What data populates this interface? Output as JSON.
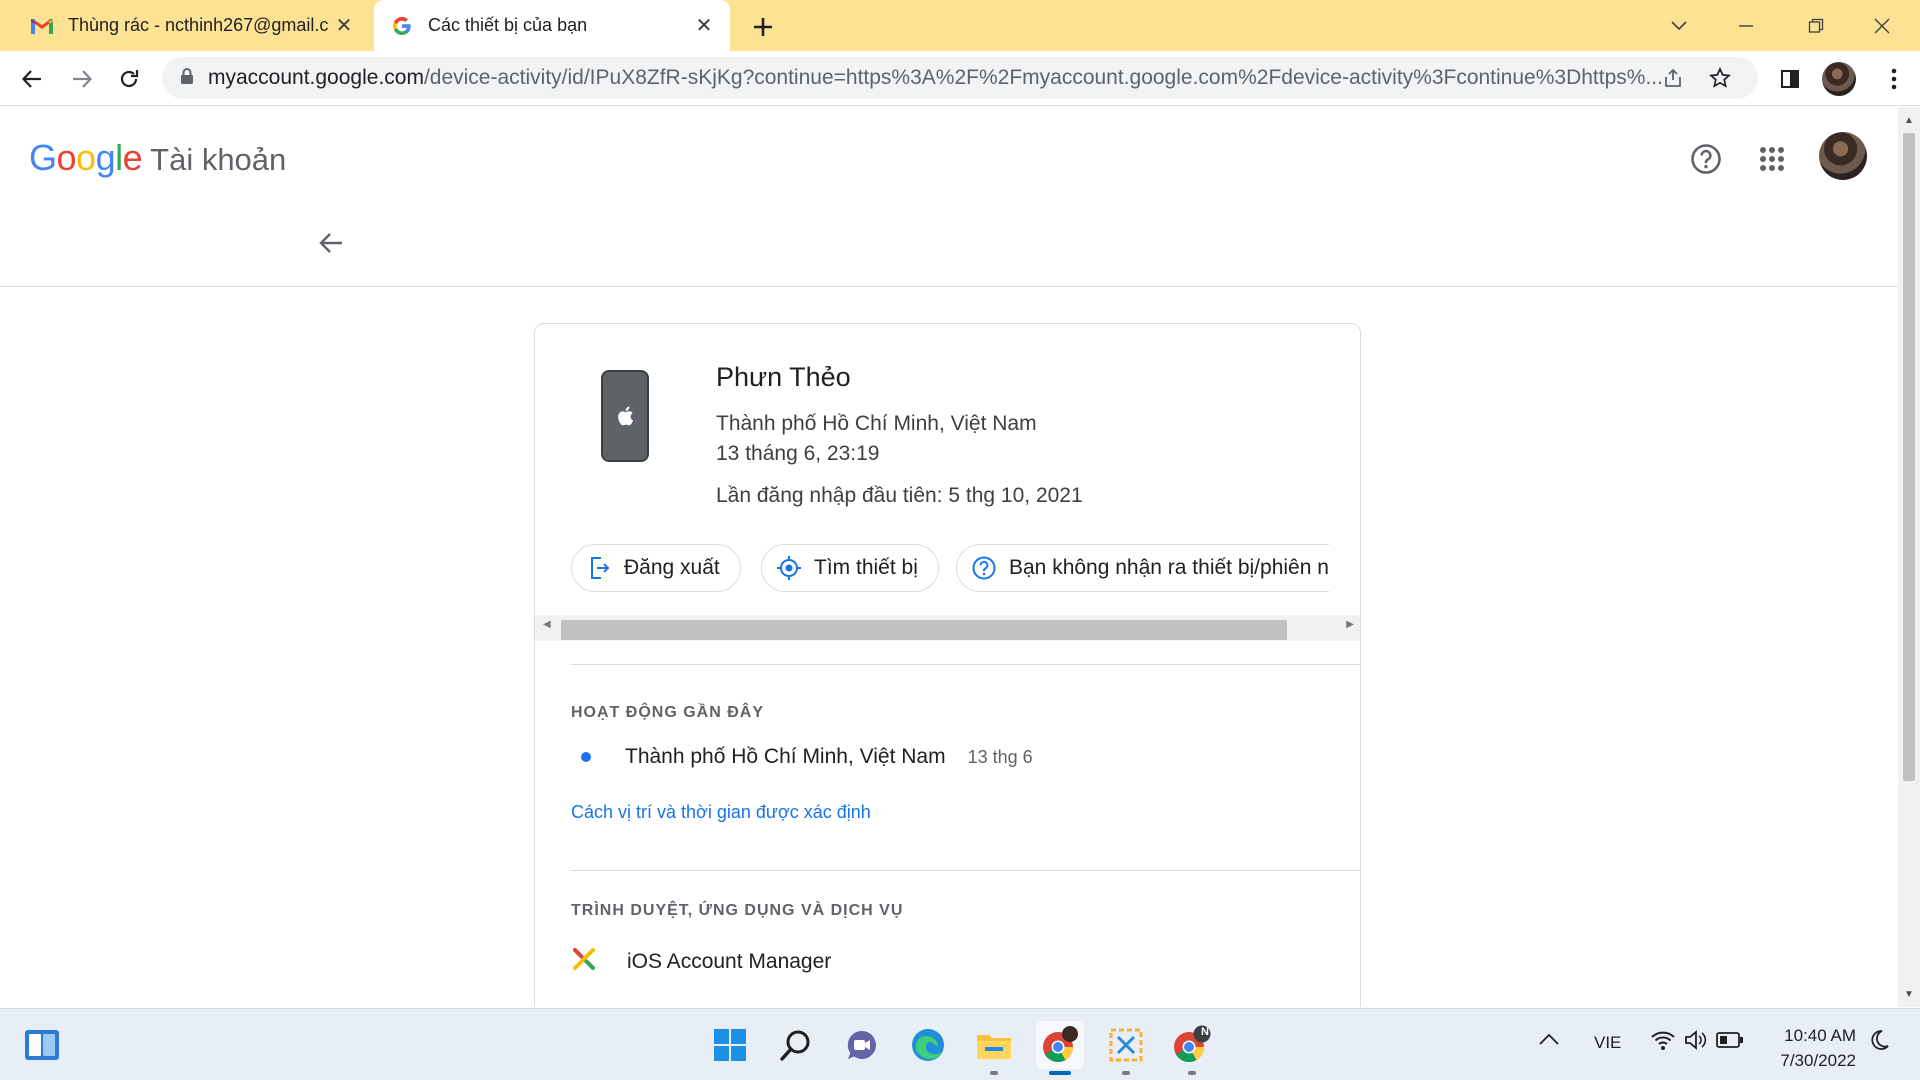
{
  "browser": {
    "tabs": [
      {
        "title": "Thùng rác - ncthinh267@gmail.c",
        "favicon": "gmail-icon",
        "active": false
      },
      {
        "title": "Các thiết bị của bạn",
        "favicon": "google-g-icon",
        "active": true
      }
    ],
    "url_host": "myaccount.google.com",
    "url_path": "/device-activity/id/IPuX8ZfR-sKjKg?continue=https%3A%2F%2Fmyaccount.google.com%2Fdevice-activity%3Fcontinue%3Dhttps%..."
  },
  "header": {
    "logo_text": "Google",
    "product": "Tài khoản"
  },
  "device": {
    "name": "Phưn Thẻo",
    "location": "Thành phố Hồ Chí Minh, Việt Nam",
    "last_active": "13 tháng 6, 23:19",
    "first_signin": "Lần đăng nhập đầu tiên: 5 thg 10, 2021",
    "icon": "iphone-icon"
  },
  "actions": {
    "sign_out": "Đăng xuất",
    "find_device": "Tìm thiết bị",
    "dont_recognize": "Bạn không nhận ra thiết bị/phiên n"
  },
  "recent_activity": {
    "title": "HOẠT ĐỘNG GẦN ĐÂY",
    "items": [
      {
        "place": "Thành phố Hồ Chí Minh, Việt Nam",
        "date": "13 thg 6"
      }
    ],
    "link": "Cách vị trí và thời gian được xác định"
  },
  "apps": {
    "title": "TRÌNH DUYỆT, ỨNG DỤNG VÀ DỊCH VỤ",
    "items": [
      {
        "name": "iOS Account Manager",
        "icon": "ios-account-manager-icon"
      }
    ]
  },
  "taskbar": {
    "language": "VIE",
    "time": "10:40 AM",
    "date": "7/30/2022",
    "chrome_badge": "N"
  },
  "colors": {
    "tabstrip": "#fde293",
    "accent": "#1a73e8",
    "google_blue": "#4285f4",
    "google_red": "#ea4335",
    "google_yellow": "#fbbc05",
    "google_green": "#34a853"
  }
}
